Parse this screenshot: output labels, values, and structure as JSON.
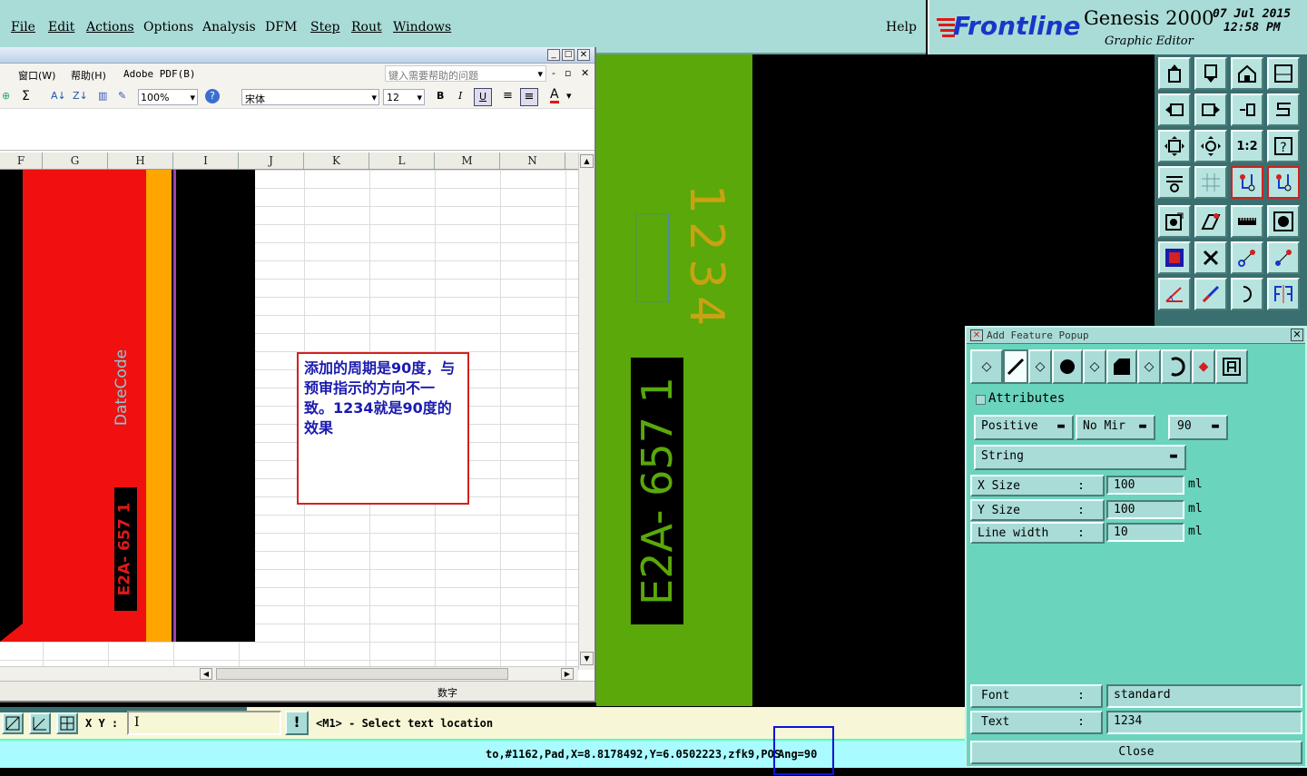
{
  "menu": {
    "file": "File",
    "edit": "Edit",
    "actions": "Actions",
    "options": "Options",
    "analysis": "Analysis",
    "dfm": "DFM",
    "step": "Step",
    "rout": "Rout",
    "windows": "Windows",
    "help": "Help"
  },
  "logo": {
    "brand": "Frontline",
    "product": "Genesis 2000",
    "subtitle": "Graphic Editor",
    "date": "07 Jul 2015",
    "time": "12:58 PM"
  },
  "excel": {
    "menu_window": "窗口(W)",
    "menu_help": "帮助(H)",
    "menu_pdf": "Adobe PDF(B)",
    "help_placeholder": "键入需要帮助的问题",
    "zoom": "100%",
    "font": "宋体",
    "font_size": "12",
    "columns": [
      "F",
      "G",
      "H",
      "I",
      "J",
      "K",
      "L",
      "M",
      "N"
    ],
    "status_num": "数字",
    "datecode": "DateCode",
    "marking": "E2A- 657 1",
    "comment": "添加的周期是90度，与预审指示的方向不一致。1234就是90度的效果"
  },
  "canvas": {
    "text_1234": "1234",
    "text_marking": "E2A- 657 1"
  },
  "popup": {
    "title": "Add Feature Popup",
    "attributes": "Attributes",
    "polarity": "Positive",
    "mirror": "No Mir",
    "angle": "90",
    "type": "String",
    "x_size_label": "X Size",
    "x_size": "100",
    "y_size_label": "Y Size",
    "y_size": "100",
    "line_width_label": "Line width",
    "line_width": "10",
    "unit": "ml",
    "colon": ":",
    "font_label": "Font",
    "font_value": "standard",
    "text_label": "Text",
    "text_value": "1234",
    "close": "Close"
  },
  "cmd": {
    "xy_label": "X Y :",
    "prompt": "<M1> - Select text location"
  },
  "status": {
    "text": "to,#1162,Pad,X=8.8178492,Y=6.0502223,zfk9,POS",
    "angle": "Ang=90"
  },
  "colors": {
    "accent_red": "#d42020",
    "board_green": "#5aa80a",
    "popup_bg": "#6bd4bd",
    "highlight_blue": "#0a14d8"
  }
}
